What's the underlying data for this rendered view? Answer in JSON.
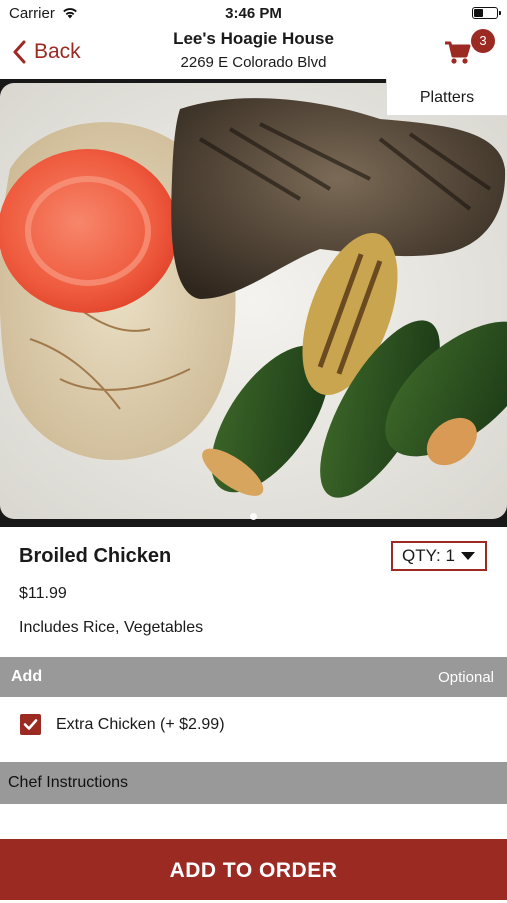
{
  "status_bar": {
    "carrier": "Carrier",
    "time": "3:46 PM"
  },
  "nav": {
    "back_label": "Back",
    "store_name": "Lee's Hoagie House",
    "store_address": "2269 E Colorado Blvd",
    "cart_count": "3"
  },
  "hero": {
    "category_tag": "Platters"
  },
  "item": {
    "name": "Broiled Chicken",
    "price": "$11.99",
    "description": "Includes Rice, Vegetables",
    "qty_label": "QTY: 1"
  },
  "add_section": {
    "title": "Add",
    "optional_label": "Optional",
    "options": [
      {
        "label": "Extra Chicken (+ $2.99)",
        "checked": true
      }
    ]
  },
  "chef_instructions": {
    "title": "Chef Instructions"
  },
  "footer": {
    "add_to_order_label": "ADD TO ORDER"
  },
  "colors": {
    "accent": "#9b2a23",
    "section_bar": "#999999"
  },
  "icons": [
    "wifi-icon",
    "battery-icon",
    "back-chevron-icon",
    "cart-icon",
    "dropdown-caret-icon",
    "checkmark-icon"
  ]
}
